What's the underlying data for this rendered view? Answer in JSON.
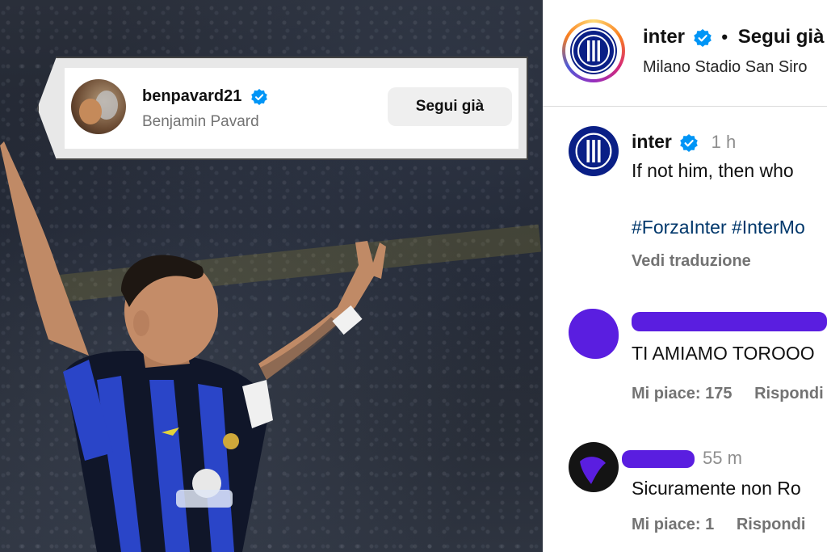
{
  "suggestion_card": {
    "username": "benpavard21",
    "full_name": "Benjamin Pavard",
    "follow_button": "Segui già"
  },
  "post_header": {
    "account": "inter",
    "separator": "•",
    "follow_status": "Segui già",
    "location": "Milano Stadio San Siro"
  },
  "caption": {
    "account": "inter",
    "time": "1 h",
    "text": "If not him, then who",
    "hashtags": "#ForzaInter #InterMo",
    "translate_label": "Vedi traduzione"
  },
  "comments": [
    {
      "text": "TI AMIAMO TOROOO",
      "likes_label": "Mi piace: 175",
      "reply_label": "Rispondi"
    },
    {
      "time": "55 m",
      "text": "Sicuramente non Ro",
      "likes_label": "Mi piace: 1",
      "reply_label": "Rispondi"
    }
  ],
  "colors": {
    "verified_badge": "#0095f6",
    "inter_blue": "#0a1f86",
    "redaction": "#5a1ee0"
  }
}
